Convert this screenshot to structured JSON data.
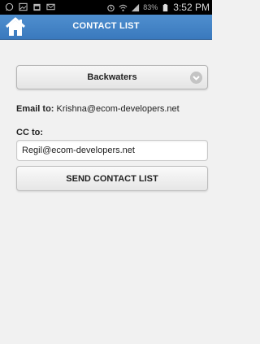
{
  "status_bar": {
    "time": "3:52 PM",
    "battery": "83%",
    "icons": [
      "whatsapp-icon",
      "gallery-icon",
      "calendar-icon",
      "mail-icon",
      "alarm-icon",
      "wifi-icon",
      "signal-icon",
      "battery-icon"
    ]
  },
  "header": {
    "title": "CONTACT LIST",
    "home_icon": "home-icon",
    "background": "#3f82c6"
  },
  "location_select": {
    "selected": "Backwaters"
  },
  "email": {
    "label": "Email to:",
    "value": "Krishna@ecom-developers.net"
  },
  "cc": {
    "label": "CC to:",
    "value": "Regil@ecom-developers.net"
  },
  "actions": {
    "send_label": "SEND CONTACT LIST"
  }
}
